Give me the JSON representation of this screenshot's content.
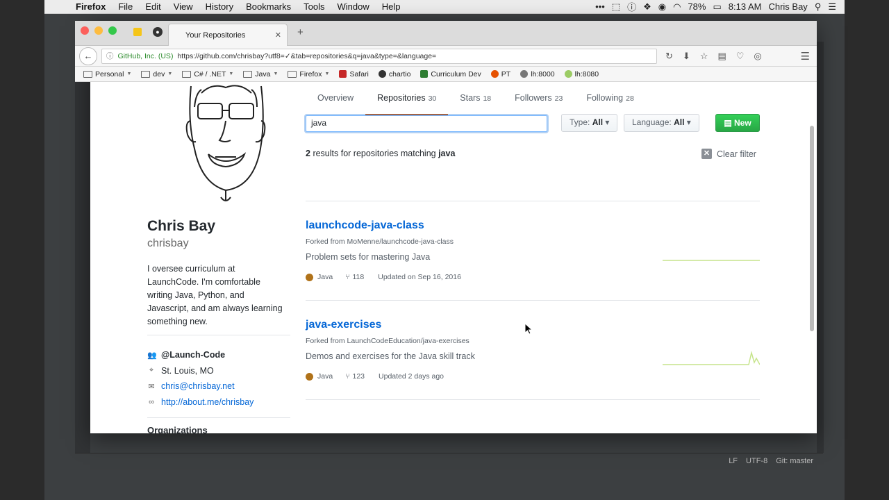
{
  "menubar": {
    "app": "Firefox",
    "items": [
      "File",
      "Edit",
      "View",
      "History",
      "Bookmarks",
      "Tools",
      "Window",
      "Help"
    ],
    "battery": "78%",
    "time": "8:13 AM",
    "user": "Chris Bay"
  },
  "browser": {
    "tab_title": "Your Repositories",
    "identity": "GitHub, Inc. (US)",
    "url": "https://github.com/chrisbay?utf8=✓&tab=repositories&q=java&type=&language=",
    "bookmarks": [
      {
        "label": "Personal",
        "kind": "folder",
        "dropdown": true
      },
      {
        "label": "dev",
        "kind": "folder",
        "dropdown": true
      },
      {
        "label": "C# / .NET",
        "kind": "folder",
        "dropdown": true
      },
      {
        "label": "Java",
        "kind": "folder",
        "dropdown": true
      },
      {
        "label": "Firefox",
        "kind": "folder",
        "dropdown": true
      },
      {
        "label": "Safari",
        "kind": "site",
        "color": "#c62828"
      },
      {
        "label": "chartio",
        "kind": "site",
        "color": "#333333"
      },
      {
        "label": "Curriculum Dev",
        "kind": "site",
        "color": "#2e7d32"
      },
      {
        "label": "PT",
        "kind": "site",
        "color": "#e65100"
      },
      {
        "label": "lh:8000",
        "kind": "site",
        "color": "#777777"
      },
      {
        "label": "lh:8080",
        "kind": "site",
        "color": "#9ccc65"
      }
    ]
  },
  "profile": {
    "name": "Chris Bay",
    "username": "chrisbay",
    "bio": "I oversee curriculum at LaunchCode. I'm comfortable writing Java, Python, and Javascript, and am always learning something new.",
    "org": "@Launch-Code",
    "location": "St. Louis, MO",
    "email": "chris@chrisbay.net",
    "website": "http://about.me/chrisbay",
    "partial_heading": "Organizations"
  },
  "nav": {
    "tabs": [
      {
        "label": "Overview",
        "count": ""
      },
      {
        "label": "Repositories",
        "count": "30"
      },
      {
        "label": "Stars",
        "count": "18"
      },
      {
        "label": "Followers",
        "count": "23"
      },
      {
        "label": "Following",
        "count": "28"
      }
    ],
    "active": "Repositories"
  },
  "filters": {
    "query": "java",
    "type_label": "Type:",
    "type_value": "All",
    "language_label": "Language:",
    "language_value": "All",
    "new_label": "New"
  },
  "results": {
    "count": "2",
    "text": "results for repositories matching",
    "term": "java",
    "clear_label": "Clear filter"
  },
  "repos": [
    {
      "name": "launchcode-java-class",
      "forked_from": "Forked from MoMenne/launchcode-java-class",
      "description": "Problem sets for mastering Java",
      "language": "Java",
      "language_color": "#b07219",
      "forks": "118",
      "updated": "Updated on Sep 16, 2016"
    },
    {
      "name": "java-exercises",
      "forked_from": "Forked from LaunchCodeEducation/java-exercises",
      "description": "Demos and exercises for the Java skill track",
      "language": "Java",
      "language_color": "#b07219",
      "forks": "123",
      "updated": "Updated 2 days ago"
    }
  ],
  "ide_status": {
    "line_ending": "LF",
    "encoding": "UTF-8",
    "git": "Git: master"
  },
  "colors": {
    "accent": "#0366d6",
    "active_tab": "#e36209",
    "new_button": "#28a745",
    "spark": "#c6e48b"
  }
}
